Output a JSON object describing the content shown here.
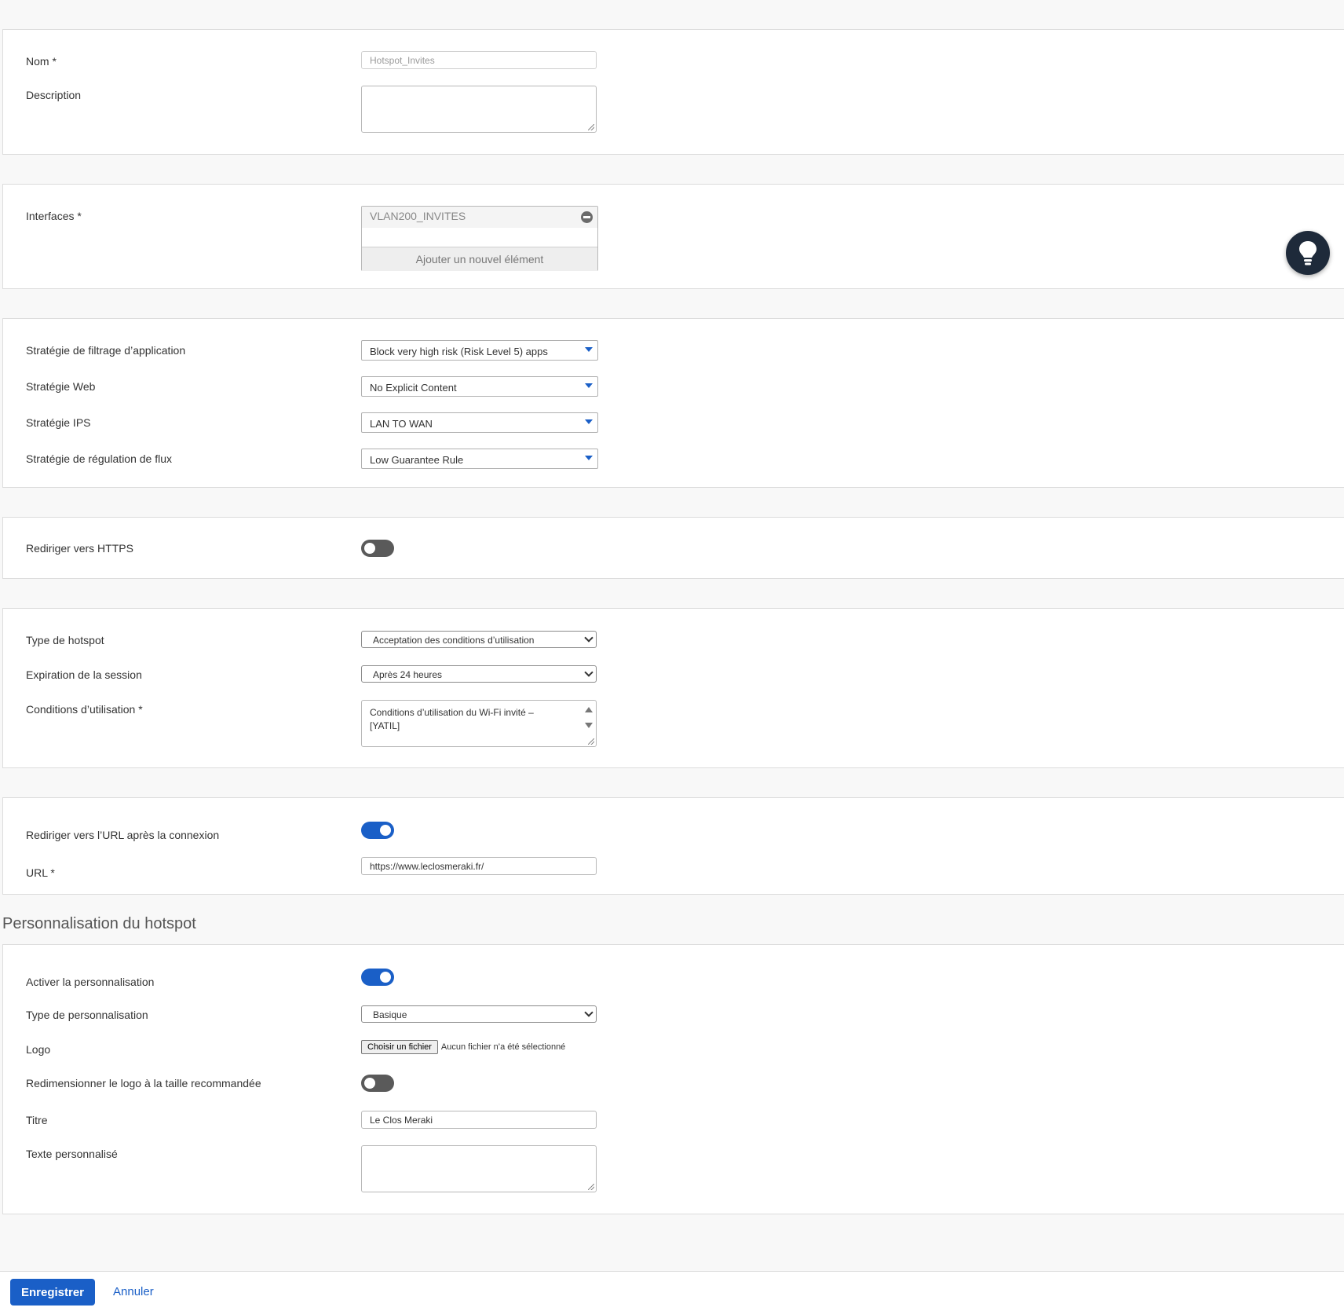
{
  "general": {
    "name_label": "Nom *",
    "name_value": "Hotspot_Invites",
    "description_label": "Description",
    "description_value": ""
  },
  "interfaces": {
    "label": "Interfaces *",
    "items": [
      "VLAN200_INVITES"
    ],
    "add_label": "Ajouter un nouvel élément"
  },
  "policies": {
    "app_filter_label": "Stratégie de filtrage d’application",
    "app_filter_value": "Block very high risk (Risk Level 5) apps",
    "web_label": "Stratégie Web",
    "web_value": "No Explicit Content",
    "ips_label": "Stratégie IPS",
    "ips_value": "LAN TO WAN",
    "traffic_label": "Stratégie de régulation de flux",
    "traffic_value": "Low Guarantee Rule"
  },
  "https": {
    "label": "Rediriger vers HTTPS",
    "enabled": false
  },
  "hotspot": {
    "type_label": "Type de hotspot",
    "type_value": "Acceptation des conditions d’utilisation",
    "expiration_label": "Expiration de la session",
    "expiration_value": "Après 24 heures",
    "terms_label": "Conditions d’utilisation *",
    "terms_value": "Conditions d’utilisation du Wi-Fi invité – [YATIL]"
  },
  "redirect": {
    "label": "Rediriger vers l’URL après la connexion",
    "enabled": true,
    "url_label": "URL *",
    "url_value": "https://www.leclosmeraki.fr/"
  },
  "customization": {
    "section_title": "Personnalisation du hotspot",
    "enable_label": "Activer la personnalisation",
    "enabled": true,
    "type_label": "Type de personnalisation",
    "type_value": "Basique",
    "logo_label": "Logo",
    "file_button": "Choisir un fichier",
    "file_note": "Aucun fichier n’a été sélectionné",
    "resize_label": "Redimensionner le logo à la taille recommandée",
    "resize_enabled": false,
    "title_label": "Titre",
    "title_value": "Le Clos Meraki",
    "custom_text_label": "Texte personnalisé",
    "custom_text_value": ""
  },
  "footer": {
    "save_label": "Enregistrer",
    "cancel_label": "Annuler"
  },
  "colors": {
    "accent": "#1a5fc7",
    "toggle_off": "#5a5a5a",
    "fab": "#1e2a3a"
  },
  "icons": {
    "fab": "lightbulb-icon",
    "remove": "minus-circle-icon"
  }
}
